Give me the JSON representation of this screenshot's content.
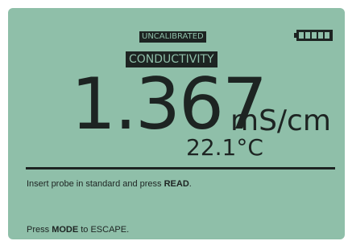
{
  "status": {
    "calibration_badge": "UNCALIBRATED",
    "mode_badge": "CONDUCTIVITY",
    "battery_icon": "battery-full-icon"
  },
  "measurement": {
    "value": "1.367",
    "unit": "mS/cm",
    "temperature": "22.1°C"
  },
  "messages": {
    "line1_prefix": "Insert probe in standard and press ",
    "line1_key": "READ",
    "line1_suffix": ".",
    "line2_prefix": "Press ",
    "line2_key": "MODE",
    "line2_suffix": " to ESCAPE."
  },
  "colors": {
    "lcd_background": "#8fbfa9",
    "lcd_foreground": "#1d2422"
  }
}
